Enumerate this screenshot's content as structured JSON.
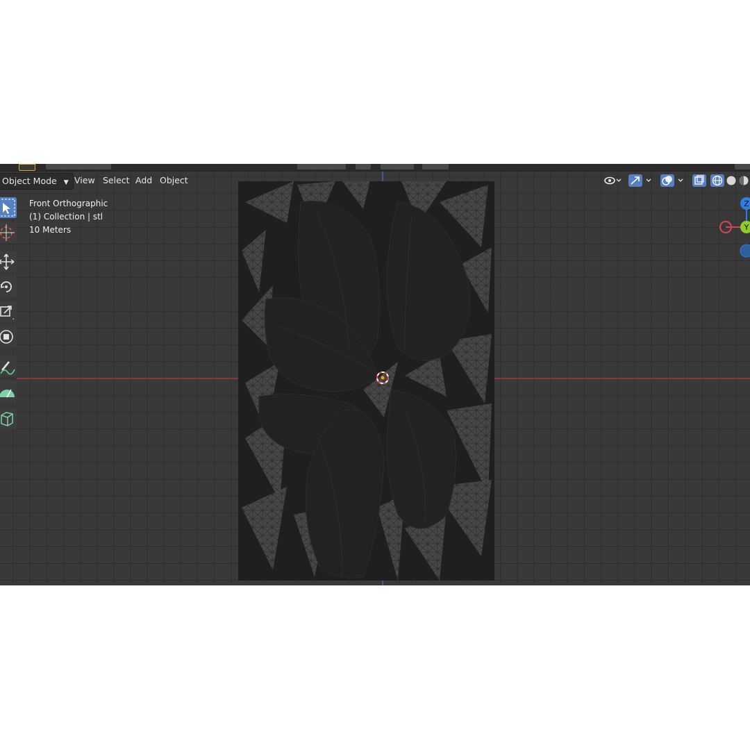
{
  "header": {
    "mode_label": "Object Mode",
    "menu": [
      "View",
      "Select",
      "Add",
      "Object"
    ]
  },
  "overlay": {
    "view_name": "Front Orthographic",
    "collection": "(1) Collection | stl",
    "scale": "10 Meters"
  },
  "toolbar": {
    "tools": [
      "select-box",
      "cursor",
      "move",
      "rotate",
      "scale",
      "transform",
      "annotate",
      "measure",
      "add-cube"
    ],
    "active": "select-box"
  },
  "gizmo": {
    "axes": [
      "Z",
      "Y",
      "X"
    ]
  },
  "colors": {
    "viewport_bg": "#393939",
    "grid_line": "#2f2f2f",
    "x_axis": "#c0393f",
    "y_axis": "#3f78c8",
    "active_tool": "#5680c2",
    "gizmo_x": "#d94552",
    "gizmo_y": "#8fcc2b",
    "gizmo_z": "#2f7fe0",
    "mesh_bg": "#1e1e1e"
  }
}
